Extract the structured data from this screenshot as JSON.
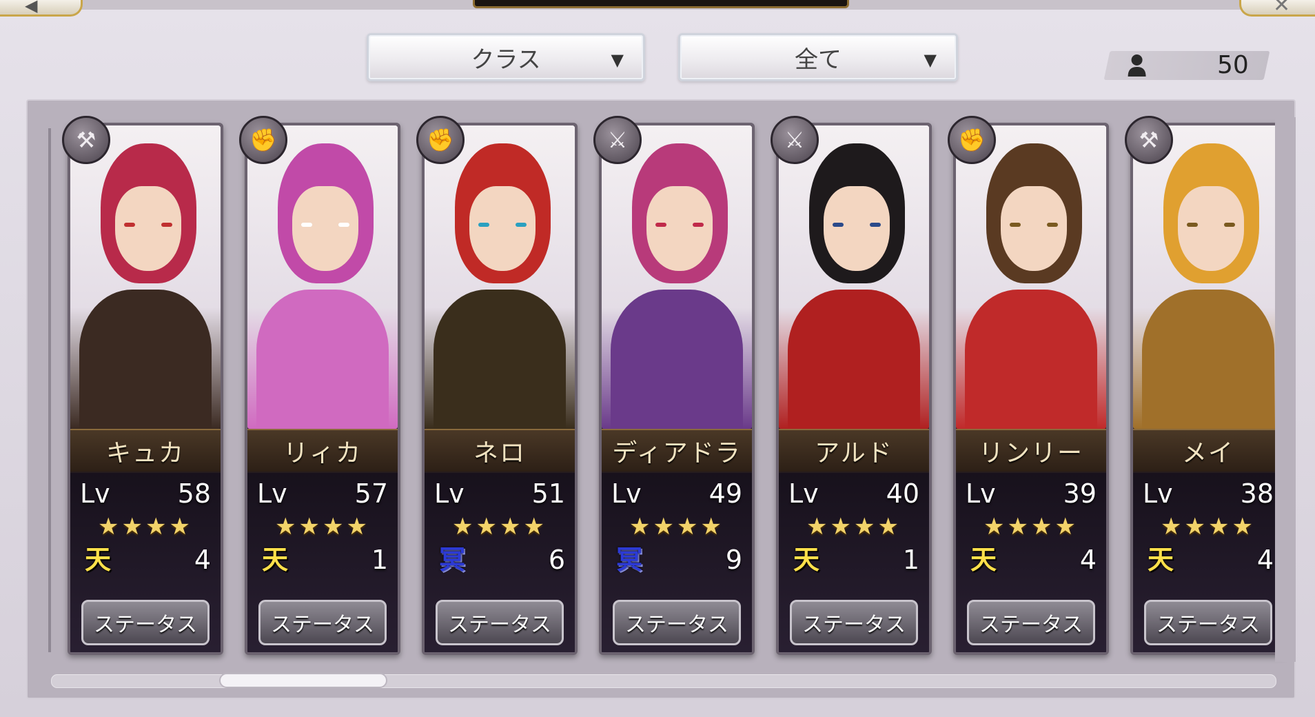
{
  "top": {
    "back_icon": "back-icon",
    "close_icon": "close-icon",
    "back_glyph": "◀",
    "close_glyph": "✕"
  },
  "filters": {
    "class_label": "クラス",
    "all_label": "全て",
    "arrow_glyph": "▼"
  },
  "unit_count": "50",
  "units": [
    {
      "name": "キュカ",
      "lv_label": "Lv",
      "level": "58",
      "stars": "★★★★",
      "element": "天",
      "element_type": "ten",
      "element_value": "4",
      "class_icon": "axe-icon",
      "class_glyph": "⚒",
      "status_label": "ステータス",
      "hair": "#b82a4a",
      "outfit": "#3b2a22",
      "eye": "#c03030"
    },
    {
      "name": "リィカ",
      "lv_label": "Lv",
      "level": "57",
      "stars": "★★★★",
      "element": "天",
      "element_type": "ten",
      "element_value": "1",
      "class_icon": "gauntlet-icon",
      "class_glyph": "✊",
      "status_label": "ステータス",
      "hair": "#c14aa8",
      "outfit": "#d06ac0",
      "eye": "#ffffff"
    },
    {
      "name": "ネロ",
      "lv_label": "Lv",
      "level": "51",
      "stars": "★★★★",
      "element": "冥",
      "element_type": "mei",
      "element_value": "6",
      "class_icon": "fist-icon",
      "class_glyph": "✊",
      "status_label": "ステータス",
      "hair": "#c02a26",
      "outfit": "#3a2e1c",
      "eye": "#2aa0c0"
    },
    {
      "name": "ディアドラ",
      "lv_label": "Lv",
      "level": "49",
      "stars": "★★★★",
      "element": "冥",
      "element_type": "mei",
      "element_value": "9",
      "class_icon": "sword-icon",
      "class_glyph": "⚔",
      "status_label": "ステータス",
      "hair": "#b83a7a",
      "outfit": "#6a3a8a",
      "eye": "#c02a4a"
    },
    {
      "name": "アルド",
      "lv_label": "Lv",
      "level": "40",
      "stars": "★★★★",
      "element": "天",
      "element_type": "ten",
      "element_value": "1",
      "class_icon": "sword-icon",
      "class_glyph": "⚔",
      "status_label": "ステータス",
      "hair": "#1e1a1c",
      "outfit": "#b02020",
      "eye": "#2a4a8a"
    },
    {
      "name": "リンリー",
      "lv_label": "Lv",
      "level": "39",
      "stars": "★★★★",
      "element": "天",
      "element_type": "ten",
      "element_value": "4",
      "class_icon": "fist-icon",
      "class_glyph": "✊",
      "status_label": "ステータス",
      "hair": "#5a3a22",
      "outfit": "#c02a2a",
      "eye": "#7a5a20"
    },
    {
      "name": "メイ",
      "lv_label": "Lv",
      "level": "38",
      "stars": "★★★★",
      "element": "天",
      "element_type": "ten",
      "element_value": "4",
      "class_icon": "hammer-icon",
      "class_glyph": "⚒",
      "status_label": "ステータス",
      "hair": "#e0a030",
      "outfit": "#a0702a",
      "eye": "#7a5a20"
    }
  ]
}
